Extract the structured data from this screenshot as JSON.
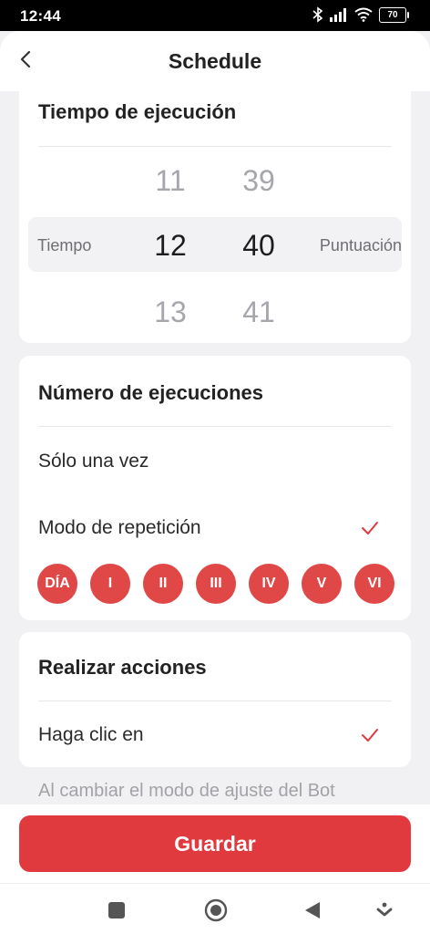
{
  "status_bar": {
    "time": "12:44",
    "battery": "70"
  },
  "header": {
    "title": "Schedule"
  },
  "run_time": {
    "title": "Tiempo de ejecución",
    "left_label": "Tiempo",
    "right_label": "Puntuación",
    "hours": {
      "above": "11",
      "selected": "12",
      "below": "13"
    },
    "minutes": {
      "above": "39",
      "selected": "40",
      "below": "41"
    }
  },
  "executions": {
    "title": "Número de ejecuciones",
    "once_label": "Sólo una vez",
    "repeat_label": "Modo de repetición",
    "repeat_selected": true,
    "days": [
      "DÍA",
      "I",
      "II",
      "III",
      "IV",
      "V",
      "VI"
    ]
  },
  "actions": {
    "title": "Realizar acciones",
    "click_label": "Haga clic en",
    "click_selected": true
  },
  "hint_text": "Al cambiar el modo de ajuste del Bot",
  "save_label": "Guardar",
  "colors": {
    "accent": "#e0393e",
    "day_bg": "#e04848",
    "bg": "#f1f1f3"
  },
  "icons": [
    "back-icon",
    "checkmark-icon",
    "bluetooth-icon",
    "signal-icon",
    "wifi-icon",
    "battery-icon",
    "recents-icon",
    "home-icon",
    "nav-back-icon",
    "nav-menu-icon"
  ]
}
